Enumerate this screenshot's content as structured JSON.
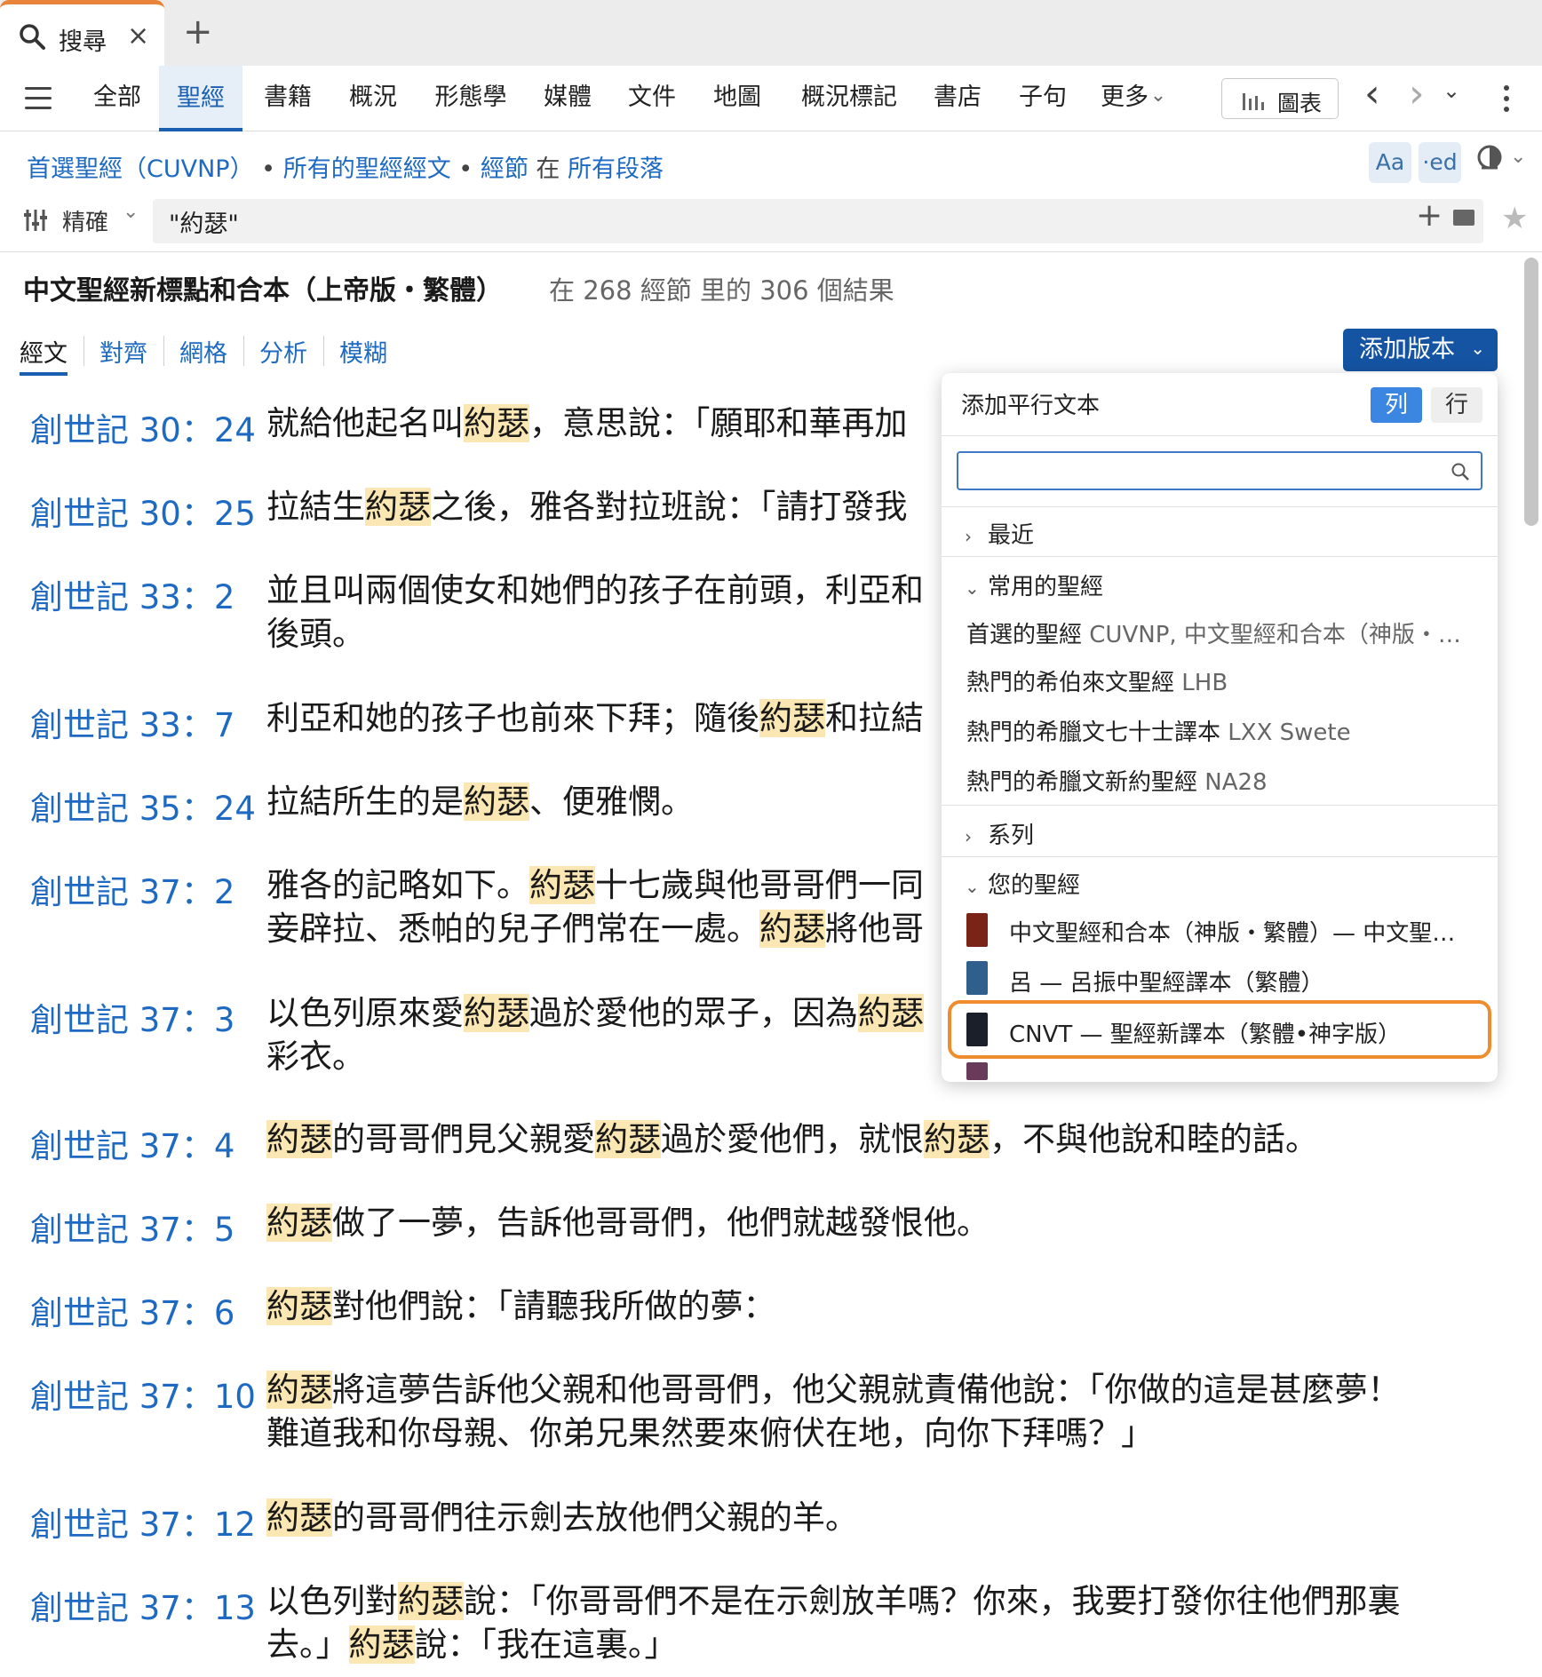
{
  "tabs": {
    "search_label": "搜尋",
    "close_glyph": "×",
    "add_glyph": "+"
  },
  "nav": {
    "items": [
      "全部",
      "聖經",
      "書籍",
      "概況",
      "形態學",
      "媒體",
      "文件",
      "地圖",
      "概況標記",
      "書店",
      "子句",
      "更多"
    ],
    "active": "聖經",
    "more_chevron": "⌄",
    "chart_label": "圖表",
    "back": "‹",
    "forward": "›",
    "history": "⌄"
  },
  "breadcrumb": {
    "bible": "首選聖經（CUVNP）",
    "sep1": "•",
    "scope": "所有的聖經經文",
    "sep2": "•",
    "unit": "經節",
    "in": "在",
    "range": "所有段落"
  },
  "toolbar_right": {
    "font": "Aa",
    "ed": "·ed",
    "theme_chev": "⌄"
  },
  "search": {
    "refine_label": "精確",
    "refine_chev": "⌄",
    "query": "\"約瑟\"",
    "add": "+",
    "star": "★"
  },
  "results": {
    "title": "中文聖經新標點和合本（上帝版・繁體）",
    "count": "在 268 經節 里的 306 個結果"
  },
  "view_tabs": [
    "經文",
    "對齊",
    "網格",
    "分析",
    "模糊"
  ],
  "add_version": {
    "label": "添加版本",
    "chev": "⌄"
  },
  "verses": [
    {
      "ref": "創世記 30：24",
      "lines": [
        [
          "就給他起名叫",
          ""
        ],
        [
          "約瑟",
          "hl"
        ],
        [
          "，意思說：「願耶和華再加",
          ""
        ]
      ]
    },
    {
      "ref": "創世記 30：25",
      "lines": [
        [
          "拉結生",
          ""
        ],
        [
          "約瑟",
          "hl"
        ],
        [
          "之後，雅各對拉班說：「請打發我",
          ""
        ]
      ]
    },
    {
      "ref": "創世記 33：2",
      "lines": [
        [
          "並且叫兩個使女和她們的孩子在前頭，利亞和",
          ""
        ]
      ],
      "line2": [
        [
          "後頭。",
          ""
        ]
      ]
    },
    {
      "ref": "創世記 33：7",
      "lines": [
        [
          "利亞和她的孩子也前來下拜；隨後",
          ""
        ],
        [
          "約瑟",
          "hl"
        ],
        [
          "和拉結",
          ""
        ]
      ]
    },
    {
      "ref": "創世記 35：24",
      "lines": [
        [
          "拉結所生的是",
          ""
        ],
        [
          "約瑟",
          "hl"
        ],
        [
          "、便雅憫。",
          ""
        ]
      ]
    },
    {
      "ref": "創世記 37：2",
      "lines": [
        [
          "雅各的記略如下。",
          ""
        ],
        [
          "約瑟",
          "hl"
        ],
        [
          "十七歲與他哥哥們一同",
          ""
        ]
      ],
      "line2": [
        [
          "妾辟拉、悉帕的兒子們常在一處。",
          ""
        ],
        [
          "約瑟",
          "hl"
        ],
        [
          "將他哥",
          ""
        ]
      ]
    },
    {
      "ref": "創世記 37：3",
      "lines": [
        [
          "以色列原來愛",
          ""
        ],
        [
          "約瑟",
          "hl"
        ],
        [
          "過於愛他的眾子，因為",
          ""
        ],
        [
          "約瑟",
          "hl"
        ]
      ],
      "line2": [
        [
          "彩衣。",
          ""
        ]
      ]
    },
    {
      "ref": "創世記 37：4",
      "lines": [
        [
          "約瑟",
          "hl"
        ],
        [
          "的哥哥們見父親愛",
          ""
        ],
        [
          "約瑟",
          "hl"
        ],
        [
          "過於愛他們，就恨",
          ""
        ],
        [
          "約瑟",
          "hl"
        ],
        [
          "，不與他說和睦的話。",
          ""
        ]
      ]
    },
    {
      "ref": "創世記 37：5",
      "lines": [
        [
          "約瑟",
          "hl"
        ],
        [
          "做了一夢，告訴他哥哥們，他們就越發恨他。",
          ""
        ]
      ]
    },
    {
      "ref": "創世記 37：6",
      "lines": [
        [
          "約瑟",
          "hl"
        ],
        [
          "對他們說：「請聽我所做的夢：",
          ""
        ]
      ]
    },
    {
      "ref": "創世記 37：10",
      "lines": [
        [
          "約瑟",
          "hl"
        ],
        [
          "將這夢告訴他父親和他哥哥們，他父親就責備他說：「你做的這是甚麼夢！",
          ""
        ]
      ],
      "line2": [
        [
          "難道我和你母親、你弟兄果然要來俯伏在地，向你下拜嗎？」",
          ""
        ]
      ]
    },
    {
      "ref": "創世記 37：12",
      "lines": [
        [
          "約瑟",
          "hl"
        ],
        [
          "的哥哥們往示劍去放他們父親的羊。",
          ""
        ]
      ]
    },
    {
      "ref": "創世記 37：13",
      "lines": [
        [
          "以色列對",
          ""
        ],
        [
          "約瑟",
          "hl"
        ],
        [
          "說：「你哥哥們不是在示劍放羊嗎？你來，我要打發你往他們那裏",
          ""
        ]
      ],
      "line2": [
        [
          "去。」",
          ""
        ],
        [
          "約瑟",
          "hl"
        ],
        [
          "說：「我在這裏。」",
          ""
        ]
      ]
    }
  ],
  "popup": {
    "title": "添加平行文本",
    "seg_col": "列",
    "seg_row": "行",
    "search_value": "",
    "sections": {
      "recent": "最近",
      "common": "常用的聖經",
      "series": "系列",
      "yours": "您的聖經"
    },
    "chev_closed": "›",
    "chev_open": "⌄",
    "common_items": [
      {
        "label": "首選的聖經",
        "sub": "CUVNP, 中文聖經和合本（神版・…"
      },
      {
        "label": "熱門的希伯來文聖經",
        "sub": "LHB"
      },
      {
        "label": "熱門的希臘文七十士譯本",
        "sub": "LXX Swete"
      },
      {
        "label": "熱門的希臘文新約聖經",
        "sub": "NA28"
      }
    ],
    "your_items": [
      {
        "label": "中文聖經和合本（神版・繁體）— 中文聖…",
        "color": "#7a2418"
      },
      {
        "label": "呂 — 呂振中聖經譯本（繁體）",
        "color": "#2f5f8a"
      },
      {
        "label": "CNVT — 聖經新譯本（繁體•神字版）",
        "color": "#1b1f2a"
      }
    ],
    "highlight_color": "#ee8d2e"
  },
  "colors": {
    "link": "#1e6ac2",
    "accent": "#1554a3",
    "highlight": "#fbe7b4",
    "tab_accent": "#e8833a"
  }
}
